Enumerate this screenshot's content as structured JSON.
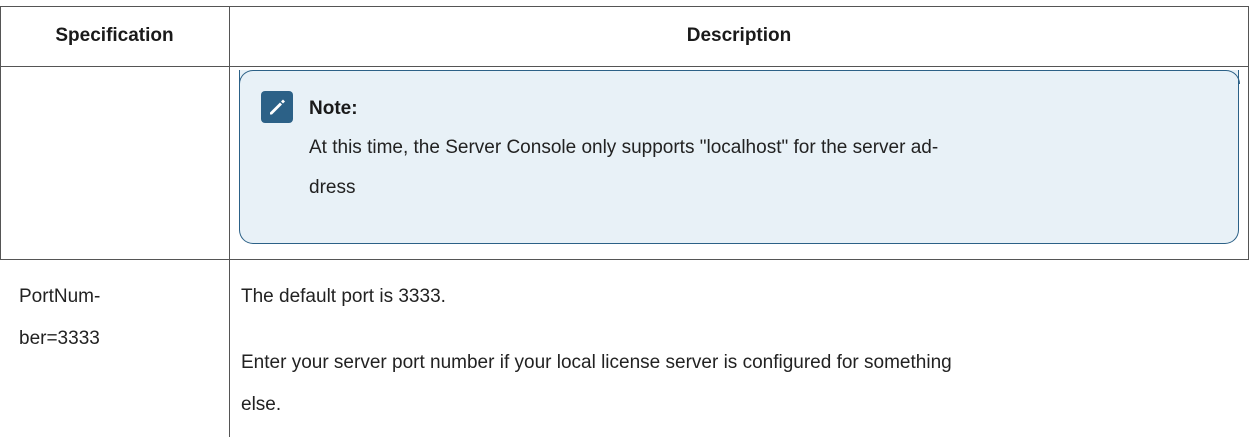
{
  "table": {
    "headers": {
      "specification": "Specification",
      "description": "Description"
    },
    "rows": [
      {
        "specification_lines": [],
        "note": {
          "icon": "pencil-note-icon",
          "title": "Note:",
          "body_lines": [
            "At this time, the Server Console only supports \"localhost\" for the server ad-",
            "dress"
          ]
        }
      },
      {
        "specification_lines": [
          "PortNum-",
          "ber=3333"
        ],
        "description_lines": [
          "The default port is 3333.",
          "Enter your server port number if your local license server is configured for something",
          "else."
        ]
      }
    ]
  },
  "colors": {
    "note_border": "#2c6187",
    "note_background": "#e8f1f7",
    "rule": "#555555"
  }
}
